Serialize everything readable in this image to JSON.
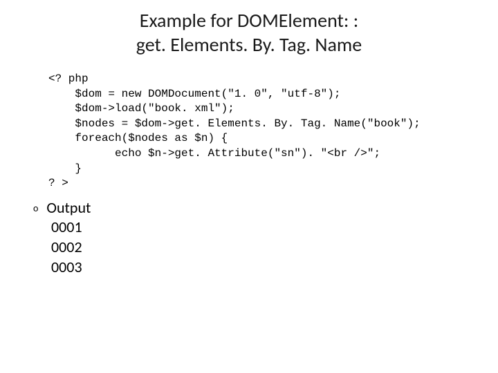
{
  "title_line1": "Example for DOMElement: :",
  "title_line2": "get. Elements. By. Tag. Name",
  "code": {
    "l1": "<? php",
    "l2": "    $dom = new DOMDocument(\"1. 0\", \"utf-8\");",
    "l3": "    $dom->load(\"book. xml\");",
    "l4": "    $nodes = $dom->get. Elements. By. Tag. Name(\"book\");",
    "l5": "    foreach($nodes as $n) {",
    "l6": "          echo $n->get. Attribute(\"sn\"). \"<br />\";",
    "l7": "    }",
    "l8": "? >"
  },
  "output": {
    "bullet": "o",
    "label": "Output",
    "v1": "0001",
    "v2": "0002",
    "v3": "0003"
  }
}
